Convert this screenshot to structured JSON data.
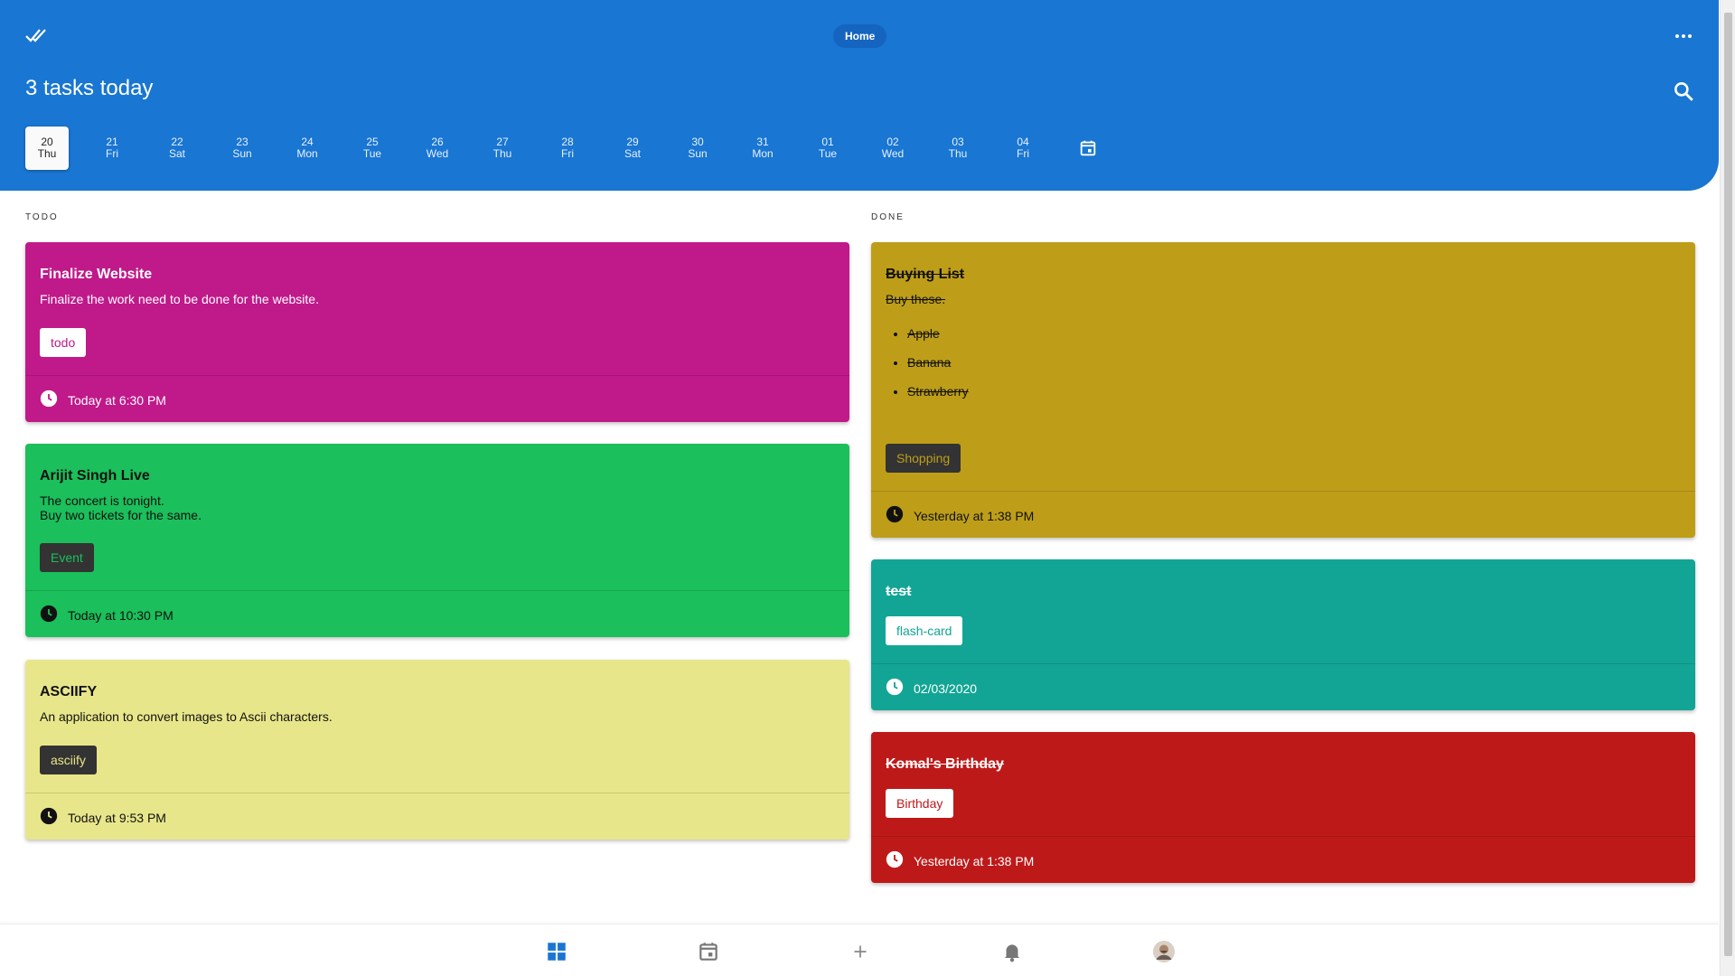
{
  "header": {
    "home_label": "Home",
    "title": "3 tasks today",
    "days": [
      {
        "num": "20",
        "dow": "Thu",
        "active": true
      },
      {
        "num": "21",
        "dow": "Fri"
      },
      {
        "num": "22",
        "dow": "Sat"
      },
      {
        "num": "23",
        "dow": "Sun"
      },
      {
        "num": "24",
        "dow": "Mon"
      },
      {
        "num": "25",
        "dow": "Tue"
      },
      {
        "num": "26",
        "dow": "Wed"
      },
      {
        "num": "27",
        "dow": "Thu"
      },
      {
        "num": "28",
        "dow": "Fri"
      },
      {
        "num": "29",
        "dow": "Sat"
      },
      {
        "num": "30",
        "dow": "Sun"
      },
      {
        "num": "31",
        "dow": "Mon"
      },
      {
        "num": "01",
        "dow": "Tue"
      },
      {
        "num": "02",
        "dow": "Wed"
      },
      {
        "num": "03",
        "dow": "Thu"
      },
      {
        "num": "04",
        "dow": "Fri"
      }
    ]
  },
  "todo": {
    "label": "TODO",
    "cards": [
      {
        "title": "Finalize Website",
        "desc": "Finalize the work need to be done for the website.",
        "tag": "todo",
        "time": "Today at 6:30 PM",
        "bg": "#c0198a",
        "fg": "#ffffff",
        "tag_bg": "#ffffff",
        "tag_fg": "#c0198a"
      },
      {
        "title": "Arijit Singh Live",
        "desc": "The concert is tonight.\nBuy two tickets for the same.",
        "tag": "Event",
        "time": "Today at 10:30 PM",
        "bg": "#1bbf5b",
        "fg": "#111111",
        "tag_bg": "#333333",
        "tag_fg": "#1bbf5b"
      },
      {
        "title": "ASCIIFY",
        "desc": "An application to convert images to Ascii characters.",
        "tag": "asciify",
        "time": "Today at 9:53 PM",
        "bg": "#e8e68a",
        "fg": "#111111",
        "tag_bg": "#333333",
        "tag_fg": "#e8e68a"
      }
    ]
  },
  "done": {
    "label": "DONE",
    "cards": [
      {
        "title": "Buying List",
        "desc": "Buy these.",
        "list": [
          "Apple",
          "Banana",
          "Strawberry"
        ],
        "tag": "Shopping",
        "time": "Yesterday at 1:38 PM",
        "bg": "#be9e19",
        "fg": "#111111",
        "tag_bg": "#333333",
        "tag_fg": "#be9e19"
      },
      {
        "title": "test",
        "tag": "flash-card",
        "time": "02/03/2020",
        "bg": "#12a595",
        "fg": "#ffffff",
        "tag_bg": "#ffffff",
        "tag_fg": "#12a595"
      },
      {
        "title": "Komal's Birthday",
        "tag": "Birthday",
        "time": "Yesterday at 1:38 PM",
        "bg": "#be1919",
        "fg": "#ffffff",
        "tag_bg": "#ffffff",
        "tag_fg": "#be1919"
      }
    ]
  },
  "icons": {
    "logo": "double-check-icon",
    "more": "more-horizontal-icon",
    "search": "search-icon",
    "calendar": "calendar-icon",
    "clock": "clock-icon",
    "nav": [
      "dashboard-icon",
      "calendar-icon",
      "plus-icon",
      "bell-icon",
      "avatar"
    ]
  },
  "colors": {
    "primary": "#1976d2"
  }
}
